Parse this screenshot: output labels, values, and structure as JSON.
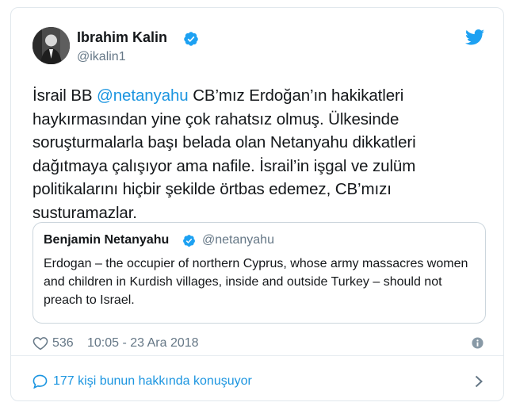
{
  "author": {
    "name": "Ibrahim Kalin",
    "handle": "@ikalin1"
  },
  "tweet": {
    "text_before_mention": "İsrail BB ",
    "mention": "@netanyahu",
    "text_after_mention": " CB’mız Erdoğan’ın hakikatleri haykırmasından yine çok rahatsız olmuş. Ülkesinde soruşturmalarla başı belada olan Netanyahu dikkatleri dağıtmaya çalışıyor ama nafile. İsrail’in işgal ve zulüm politikalarını hiçbir şekilde örtbas edemez, CB’mızı susturamazlar."
  },
  "quoted_tweet": {
    "name": "Benjamin Netanyahu",
    "handle": "@netanyahu",
    "text": "Erdogan – the occupier of northern Cyprus, whose army massacres women and children in Kurdish villages, inside and outside Turkey – should not preach to Israel."
  },
  "meta": {
    "likes": "536",
    "timestamp": "10:05 - 23 Ara 2018"
  },
  "conversation": {
    "label": "177 kişi bunun hakkında konuşuyor"
  },
  "icons": {
    "verified": "verified-badge-icon",
    "brand": "twitter-bird-icon",
    "like": "heart-icon",
    "info": "info-icon",
    "reply": "speech-bubble-icon",
    "next": "chevron-right-icon"
  },
  "colors": {
    "accent": "#1da1f2",
    "link": "#1b95e0",
    "secondary_text": "#657786",
    "border": "#e1e8ed"
  }
}
